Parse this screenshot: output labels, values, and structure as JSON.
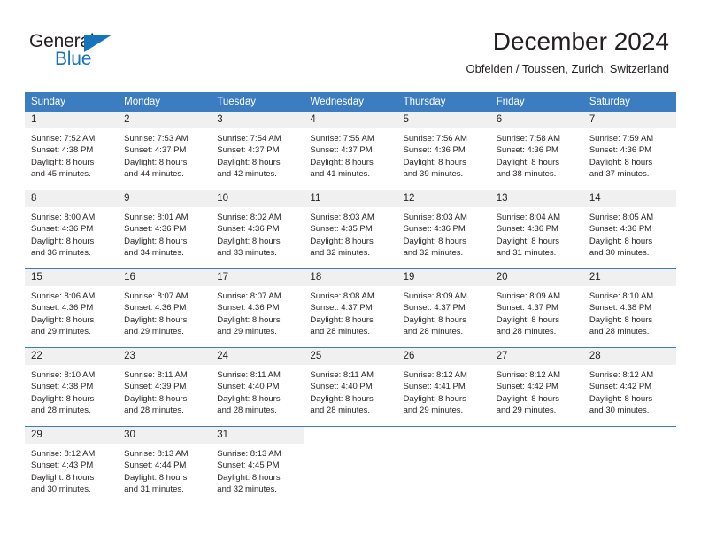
{
  "brand": {
    "name_part1": "General",
    "name_part2": "Blue",
    "triangle_color": "#1574bb",
    "text_color": "#231f20"
  },
  "header": {
    "title": "December 2024",
    "subtitle": "Obfelden / Toussen, Zurich, Switzerland"
  },
  "theme": {
    "header_row_bg": "#3b7dc0",
    "header_row_text": "#ffffff",
    "daynum_bg": "#f0f0f0",
    "cell_bg": "#ffffff",
    "grid_line": "#3b7dc0",
    "body_text": "#231f20"
  },
  "weekday_headers": [
    "Sunday",
    "Monday",
    "Tuesday",
    "Wednesday",
    "Thursday",
    "Friday",
    "Saturday"
  ],
  "weeks": [
    [
      {
        "day": "1",
        "sunrise": "Sunrise: 7:52 AM",
        "sunset": "Sunset: 4:38 PM",
        "daylight_line1": "Daylight: 8 hours",
        "daylight_line2": "and 45 minutes."
      },
      {
        "day": "2",
        "sunrise": "Sunrise: 7:53 AM",
        "sunset": "Sunset: 4:37 PM",
        "daylight_line1": "Daylight: 8 hours",
        "daylight_line2": "and 44 minutes."
      },
      {
        "day": "3",
        "sunrise": "Sunrise: 7:54 AM",
        "sunset": "Sunset: 4:37 PM",
        "daylight_line1": "Daylight: 8 hours",
        "daylight_line2": "and 42 minutes."
      },
      {
        "day": "4",
        "sunrise": "Sunrise: 7:55 AM",
        "sunset": "Sunset: 4:37 PM",
        "daylight_line1": "Daylight: 8 hours",
        "daylight_line2": "and 41 minutes."
      },
      {
        "day": "5",
        "sunrise": "Sunrise: 7:56 AM",
        "sunset": "Sunset: 4:36 PM",
        "daylight_line1": "Daylight: 8 hours",
        "daylight_line2": "and 39 minutes."
      },
      {
        "day": "6",
        "sunrise": "Sunrise: 7:58 AM",
        "sunset": "Sunset: 4:36 PM",
        "daylight_line1": "Daylight: 8 hours",
        "daylight_line2": "and 38 minutes."
      },
      {
        "day": "7",
        "sunrise": "Sunrise: 7:59 AM",
        "sunset": "Sunset: 4:36 PM",
        "daylight_line1": "Daylight: 8 hours",
        "daylight_line2": "and 37 minutes."
      }
    ],
    [
      {
        "day": "8",
        "sunrise": "Sunrise: 8:00 AM",
        "sunset": "Sunset: 4:36 PM",
        "daylight_line1": "Daylight: 8 hours",
        "daylight_line2": "and 36 minutes."
      },
      {
        "day": "9",
        "sunrise": "Sunrise: 8:01 AM",
        "sunset": "Sunset: 4:36 PM",
        "daylight_line1": "Daylight: 8 hours",
        "daylight_line2": "and 34 minutes."
      },
      {
        "day": "10",
        "sunrise": "Sunrise: 8:02 AM",
        "sunset": "Sunset: 4:36 PM",
        "daylight_line1": "Daylight: 8 hours",
        "daylight_line2": "and 33 minutes."
      },
      {
        "day": "11",
        "sunrise": "Sunrise: 8:03 AM",
        "sunset": "Sunset: 4:35 PM",
        "daylight_line1": "Daylight: 8 hours",
        "daylight_line2": "and 32 minutes."
      },
      {
        "day": "12",
        "sunrise": "Sunrise: 8:03 AM",
        "sunset": "Sunset: 4:36 PM",
        "daylight_line1": "Daylight: 8 hours",
        "daylight_line2": "and 32 minutes."
      },
      {
        "day": "13",
        "sunrise": "Sunrise: 8:04 AM",
        "sunset": "Sunset: 4:36 PM",
        "daylight_line1": "Daylight: 8 hours",
        "daylight_line2": "and 31 minutes."
      },
      {
        "day": "14",
        "sunrise": "Sunrise: 8:05 AM",
        "sunset": "Sunset: 4:36 PM",
        "daylight_line1": "Daylight: 8 hours",
        "daylight_line2": "and 30 minutes."
      }
    ],
    [
      {
        "day": "15",
        "sunrise": "Sunrise: 8:06 AM",
        "sunset": "Sunset: 4:36 PM",
        "daylight_line1": "Daylight: 8 hours",
        "daylight_line2": "and 29 minutes."
      },
      {
        "day": "16",
        "sunrise": "Sunrise: 8:07 AM",
        "sunset": "Sunset: 4:36 PM",
        "daylight_line1": "Daylight: 8 hours",
        "daylight_line2": "and 29 minutes."
      },
      {
        "day": "17",
        "sunrise": "Sunrise: 8:07 AM",
        "sunset": "Sunset: 4:36 PM",
        "daylight_line1": "Daylight: 8 hours",
        "daylight_line2": "and 29 minutes."
      },
      {
        "day": "18",
        "sunrise": "Sunrise: 8:08 AM",
        "sunset": "Sunset: 4:37 PM",
        "daylight_line1": "Daylight: 8 hours",
        "daylight_line2": "and 28 minutes."
      },
      {
        "day": "19",
        "sunrise": "Sunrise: 8:09 AM",
        "sunset": "Sunset: 4:37 PM",
        "daylight_line1": "Daylight: 8 hours",
        "daylight_line2": "and 28 minutes."
      },
      {
        "day": "20",
        "sunrise": "Sunrise: 8:09 AM",
        "sunset": "Sunset: 4:37 PM",
        "daylight_line1": "Daylight: 8 hours",
        "daylight_line2": "and 28 minutes."
      },
      {
        "day": "21",
        "sunrise": "Sunrise: 8:10 AM",
        "sunset": "Sunset: 4:38 PM",
        "daylight_line1": "Daylight: 8 hours",
        "daylight_line2": "and 28 minutes."
      }
    ],
    [
      {
        "day": "22",
        "sunrise": "Sunrise: 8:10 AM",
        "sunset": "Sunset: 4:38 PM",
        "daylight_line1": "Daylight: 8 hours",
        "daylight_line2": "and 28 minutes."
      },
      {
        "day": "23",
        "sunrise": "Sunrise: 8:11 AM",
        "sunset": "Sunset: 4:39 PM",
        "daylight_line1": "Daylight: 8 hours",
        "daylight_line2": "and 28 minutes."
      },
      {
        "day": "24",
        "sunrise": "Sunrise: 8:11 AM",
        "sunset": "Sunset: 4:40 PM",
        "daylight_line1": "Daylight: 8 hours",
        "daylight_line2": "and 28 minutes."
      },
      {
        "day": "25",
        "sunrise": "Sunrise: 8:11 AM",
        "sunset": "Sunset: 4:40 PM",
        "daylight_line1": "Daylight: 8 hours",
        "daylight_line2": "and 28 minutes."
      },
      {
        "day": "26",
        "sunrise": "Sunrise: 8:12 AM",
        "sunset": "Sunset: 4:41 PM",
        "daylight_line1": "Daylight: 8 hours",
        "daylight_line2": "and 29 minutes."
      },
      {
        "day": "27",
        "sunrise": "Sunrise: 8:12 AM",
        "sunset": "Sunset: 4:42 PM",
        "daylight_line1": "Daylight: 8 hours",
        "daylight_line2": "and 29 minutes."
      },
      {
        "day": "28",
        "sunrise": "Sunrise: 8:12 AM",
        "sunset": "Sunset: 4:42 PM",
        "daylight_line1": "Daylight: 8 hours",
        "daylight_line2": "and 30 minutes."
      }
    ],
    [
      {
        "day": "29",
        "sunrise": "Sunrise: 8:12 AM",
        "sunset": "Sunset: 4:43 PM",
        "daylight_line1": "Daylight: 8 hours",
        "daylight_line2": "and 30 minutes."
      },
      {
        "day": "30",
        "sunrise": "Sunrise: 8:13 AM",
        "sunset": "Sunset: 4:44 PM",
        "daylight_line1": "Daylight: 8 hours",
        "daylight_line2": "and 31 minutes."
      },
      {
        "day": "31",
        "sunrise": "Sunrise: 8:13 AM",
        "sunset": "Sunset: 4:45 PM",
        "daylight_line1": "Daylight: 8 hours",
        "daylight_line2": "and 32 minutes."
      },
      {
        "day": "",
        "sunrise": "",
        "sunset": "",
        "daylight_line1": "",
        "daylight_line2": ""
      },
      {
        "day": "",
        "sunrise": "",
        "sunset": "",
        "daylight_line1": "",
        "daylight_line2": ""
      },
      {
        "day": "",
        "sunrise": "",
        "sunset": "",
        "daylight_line1": "",
        "daylight_line2": ""
      },
      {
        "day": "",
        "sunrise": "",
        "sunset": "",
        "daylight_line1": "",
        "daylight_line2": ""
      }
    ]
  ]
}
